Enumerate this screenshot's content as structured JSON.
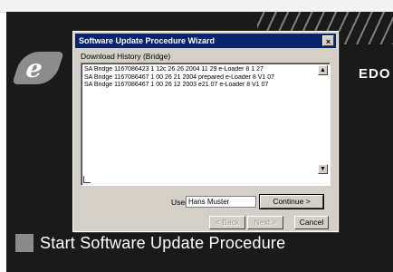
{
  "brand": {
    "logo_letter": "e",
    "name_visible": "EDO"
  },
  "dialog": {
    "title": "Software Update Procedure Wizard",
    "close_glyph": "×",
    "group_label": "Download History (Bridge)",
    "history": [
      "SA Bridge 1167086423 1 12c 26 26 2004 11 29 e-Loader 8 1 27",
      "SA Bridge 1167086467 1 00 26 21 2004 prepared e-Loader 8 V1 07",
      "SA Bridge 1167086467 1 00 26 12 2003 e21 07 e-Loader 8 V1 07"
    ],
    "userid_label": "User ID:",
    "userid_value": "Hans Muster",
    "continue_label": "Continue >",
    "back_label": "< Back",
    "next_label": "Next >",
    "cancel_label": "Cancel"
  },
  "footer": {
    "start_label": "Start Software Update Procedure"
  }
}
